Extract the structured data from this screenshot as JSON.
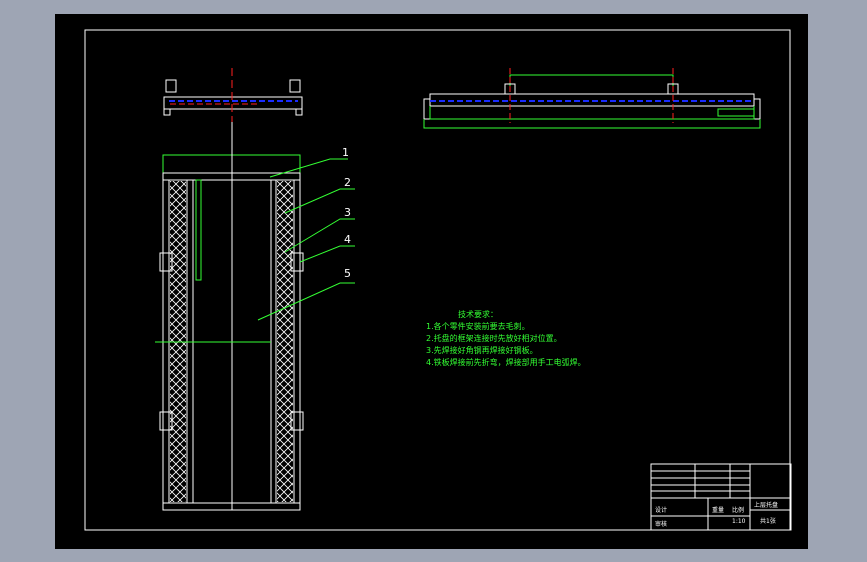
{
  "drawing": {
    "balloons": [
      "1",
      "2",
      "3",
      "4",
      "5"
    ],
    "technical_requirements": {
      "title": "技术要求：",
      "items": [
        "1.各个零件安装前要去毛刺。",
        "2.托盘的框架连接时先放好相对位置。",
        "3.先焊接好角钢再焊接好钢板。",
        "4.铁板焊接前先折弯，焊接部用手工电弧焊。"
      ]
    },
    "title_block": {
      "drawing_name": "上层托盘",
      "scale": "1:10",
      "sheet": "共1张",
      "designer_label": "设计",
      "check_label": "审核",
      "weight_label": "重量",
      "ratio_label": "比例"
    }
  },
  "colors": {
    "background": "#9ea5b4",
    "sheet": "#000000",
    "outline": "#ffffff",
    "dimension": "#33ff33",
    "hidden_line": "#1a2cff",
    "center_line": "#ff2020"
  }
}
